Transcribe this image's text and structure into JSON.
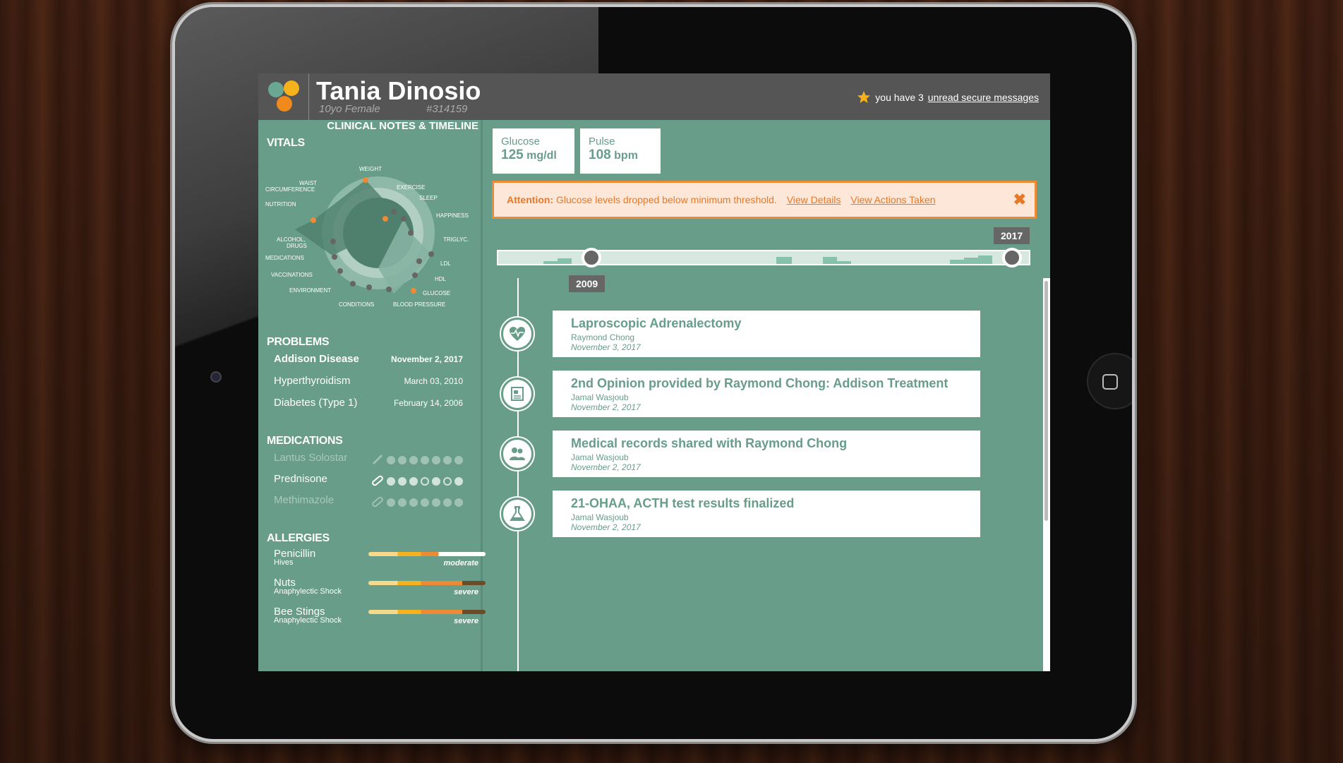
{
  "patient": {
    "name": "Tania Dinosio",
    "demographics": "10yo Female",
    "id": "#314159"
  },
  "messages": {
    "prefix": "you have 3",
    "link": "unread secure messages"
  },
  "left_tab": "CLINICAL NOTES & TIMELINE",
  "vitals": {
    "title": "VITALS",
    "axes": [
      "WEIGHT",
      "EXERCISE",
      "SLEEP",
      "HAPPINESS",
      "TRIGLYC.",
      "LDL",
      "HDL",
      "GLUCOSE",
      "BLOOD PRESSURE",
      "CONDITIONS",
      "ENVIRONMENT",
      "VACCINATIONS",
      "MEDICATIONS",
      "ALCOHOL, DRUGS",
      "NUTRITION",
      "WAIST CIRCUMFERENCE"
    ],
    "waist_label": [
      "WAIST",
      "CIRCUMFERENCE"
    ],
    "alcohol_label": [
      "ALCOHOL,",
      "DRUGS"
    ]
  },
  "problems": {
    "title": "PROBLEMS",
    "items": [
      {
        "name": "Addison Disease",
        "date": "November 2, 2017"
      },
      {
        "name": "Hyperthyroidism",
        "date": "March 03, 2010"
      },
      {
        "name": "Diabetes (Type 1)",
        "date": "February 14, 2006"
      }
    ]
  },
  "medications": {
    "title": "MEDICATIONS",
    "items": [
      {
        "name": "Lantus Solostar",
        "icon": "pen-icon"
      },
      {
        "name": "Prednisone",
        "icon": "pill-icon"
      },
      {
        "name": "Methimazole",
        "icon": "pill-icon"
      }
    ]
  },
  "allergies": {
    "title": "ALLERGIES",
    "items": [
      {
        "name": "Penicillin",
        "reaction": "Hives",
        "severity": "moderate"
      },
      {
        "name": "Nuts",
        "reaction": "Anaphylectic Shock",
        "severity": "severe"
      },
      {
        "name": "Bee Stings",
        "reaction": "Anaphylectic Shock",
        "severity": "severe"
      }
    ]
  },
  "vital_cards": [
    {
      "label": "Glucose",
      "value": "125",
      "unit": "mg/dl"
    },
    {
      "label": "Pulse",
      "value": "108",
      "unit": "bpm"
    }
  ],
  "alert": {
    "prefix": "Attention:",
    "message": "Glucose levels dropped below minimum threshold.",
    "link1": "View Details",
    "link2": "View Actions Taken",
    "close": "✖"
  },
  "timeline_range": {
    "start": "2009",
    "end": "2017"
  },
  "timeline": [
    {
      "title": "Laproscopic Adrenalectomy",
      "author": "Raymond Chong",
      "date": "November 3, 2017",
      "icon": "heart-pulse-icon"
    },
    {
      "title": "2nd Opinion provided by Raymond Chong: Addison Treatment",
      "author": "Jamal Wasjoub",
      "date": "November 2, 2017",
      "icon": "document-icon"
    },
    {
      "title": "Medical records shared with Raymond Chong",
      "author": "Jamal Wasjoub",
      "date": "November 2, 2017",
      "icon": "people-icon"
    },
    {
      "title": "21-OHAA, ACTH test results finalized",
      "author": "Jamal Wasjoub",
      "date": "November 2, 2017",
      "icon": "flask-icon"
    }
  ],
  "colors": {
    "accent": "#679d89",
    "alert": "#ee8a33",
    "logo_orange": "#f08a1c",
    "logo_yellow": "#f6b21d",
    "logo_teal": "#6aa893"
  }
}
